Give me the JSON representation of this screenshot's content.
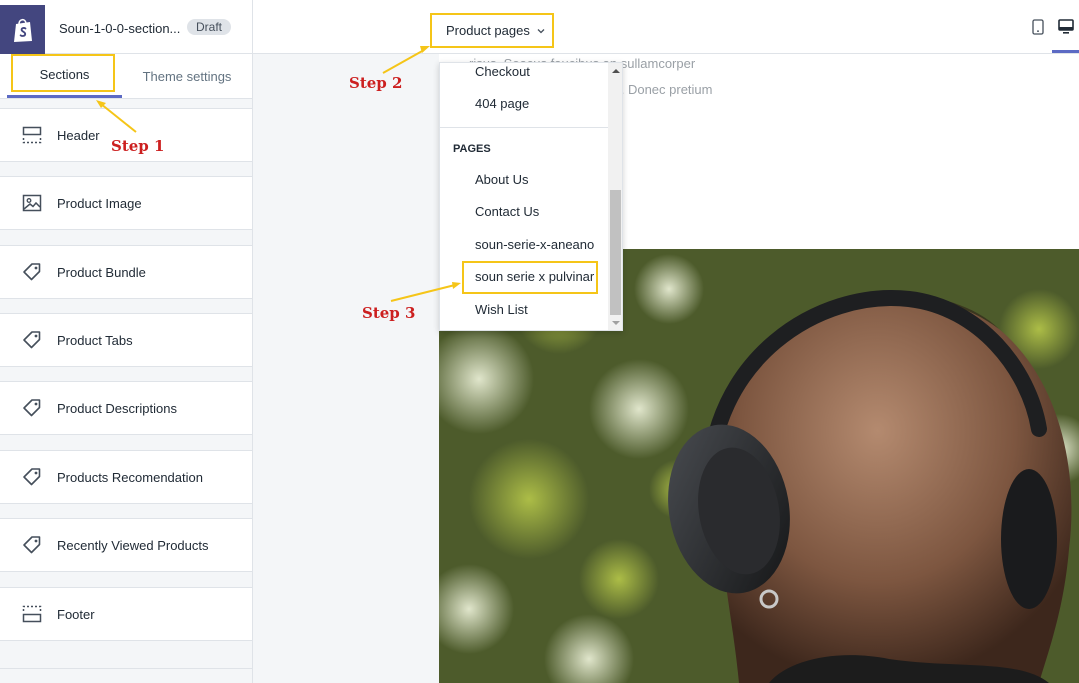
{
  "header": {
    "theme_name": "Soun-1-0-0-section...",
    "status_badge": "Draft",
    "page_selector": "Product pages"
  },
  "sidebar": {
    "tabs": [
      {
        "label": "Sections"
      },
      {
        "label": "Theme settings"
      }
    ],
    "sections": [
      {
        "label": "Header",
        "icon": "header-layout-icon"
      },
      {
        "label": "Product Image",
        "icon": "image-icon"
      },
      {
        "label": "Product Bundle",
        "icon": "tag-icon"
      },
      {
        "label": "Product Tabs",
        "icon": "tag-icon"
      },
      {
        "label": "Product Descriptions",
        "icon": "tag-icon"
      },
      {
        "label": "Products Recomendation",
        "icon": "tag-icon"
      },
      {
        "label": "Recently Viewed Products",
        "icon": "tag-icon"
      },
      {
        "label": "Footer",
        "icon": "footer-layout-icon"
      }
    ]
  },
  "dropdown": {
    "items_top": [
      {
        "label": "Checkout"
      },
      {
        "label": "404 page"
      }
    ],
    "group_heading": "PAGES",
    "pages": [
      {
        "label": "About Us"
      },
      {
        "label": "Contact Us"
      },
      {
        "label": "soun-serie-x-aneano"
      },
      {
        "label": "soun serie x pulvinar",
        "highlighted": true
      },
      {
        "label": "Wish List"
      }
    ]
  },
  "preview": {
    "text_line_1": "risus. Seacus faucibus an sullamcorper",
    "text_line_2": "mmodo pharetras loremos. Donec pretium"
  },
  "annotations": {
    "step1": "Step 1",
    "step2": "Step 2",
    "step3": "Step 3"
  },
  "colors": {
    "accent": "#5c6ac4",
    "logo_bg": "#43467f",
    "highlight_border": "#f5c518",
    "annotation_text": "#cc1f1f"
  }
}
